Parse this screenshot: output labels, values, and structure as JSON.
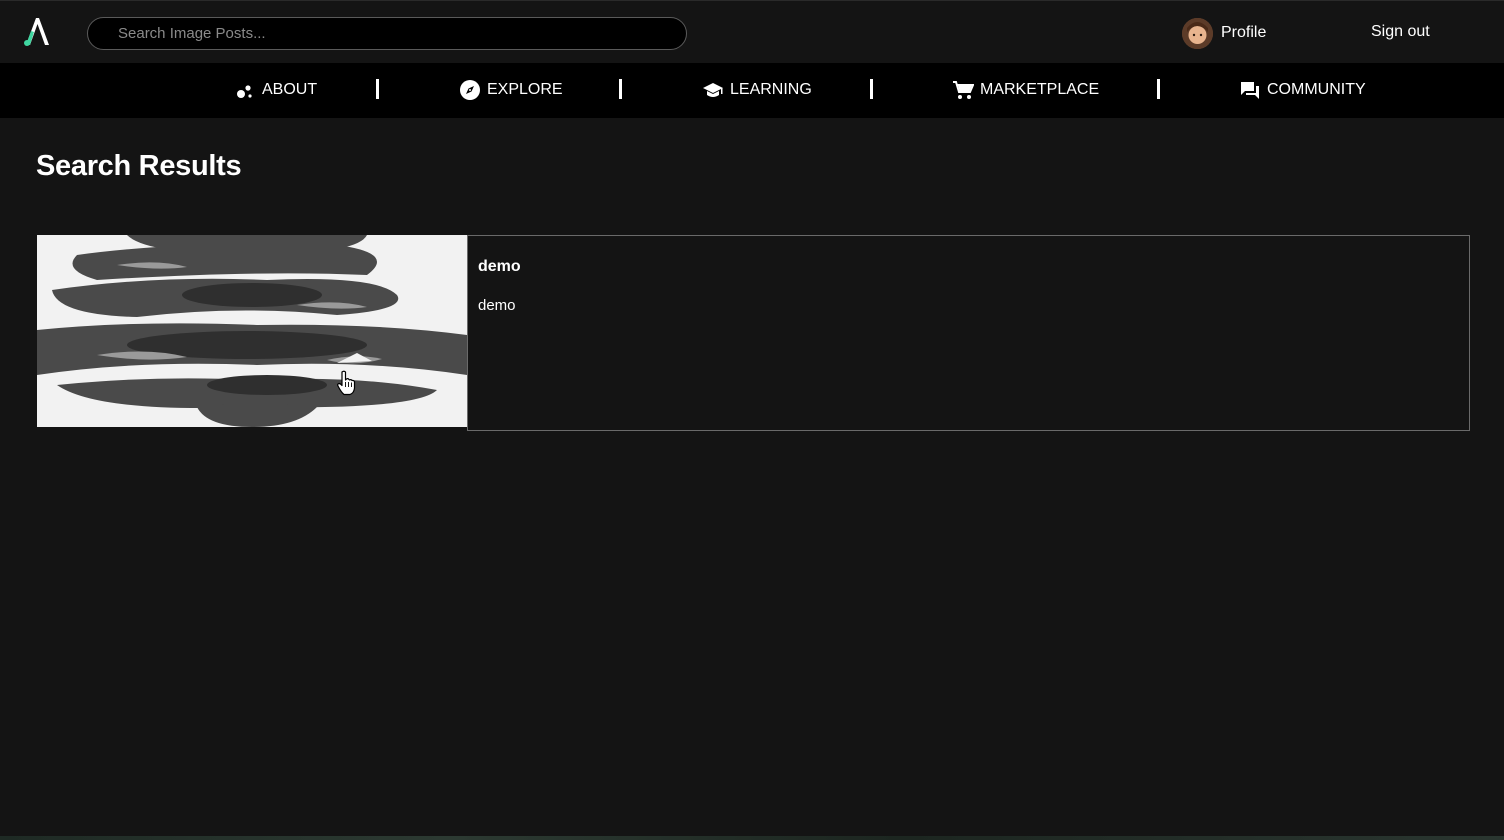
{
  "header": {
    "logo_icon": "brand-a-logo",
    "search_placeholder": "Search Image Posts...",
    "profile_label": "Profile",
    "signout_label": "Sign out"
  },
  "nav": {
    "items": [
      {
        "label": "ABOUT",
        "icon": "bubbles-icon"
      },
      {
        "label": "EXPLORE",
        "icon": "compass-icon"
      },
      {
        "label": "LEARNING",
        "icon": "graduation-cap-icon"
      },
      {
        "label": "MARKETPLACE",
        "icon": "cart-icon"
      },
      {
        "label": "COMMUNITY",
        "icon": "forum-icon"
      }
    ]
  },
  "main": {
    "title": "Search Results",
    "results": [
      {
        "title": "demo",
        "description": "demo",
        "thumbnail": "pinecone-grayscale-image"
      }
    ]
  },
  "colors": {
    "background": "#141414",
    "navbar": "#000000",
    "logo_accent": "#3fd6a0"
  }
}
